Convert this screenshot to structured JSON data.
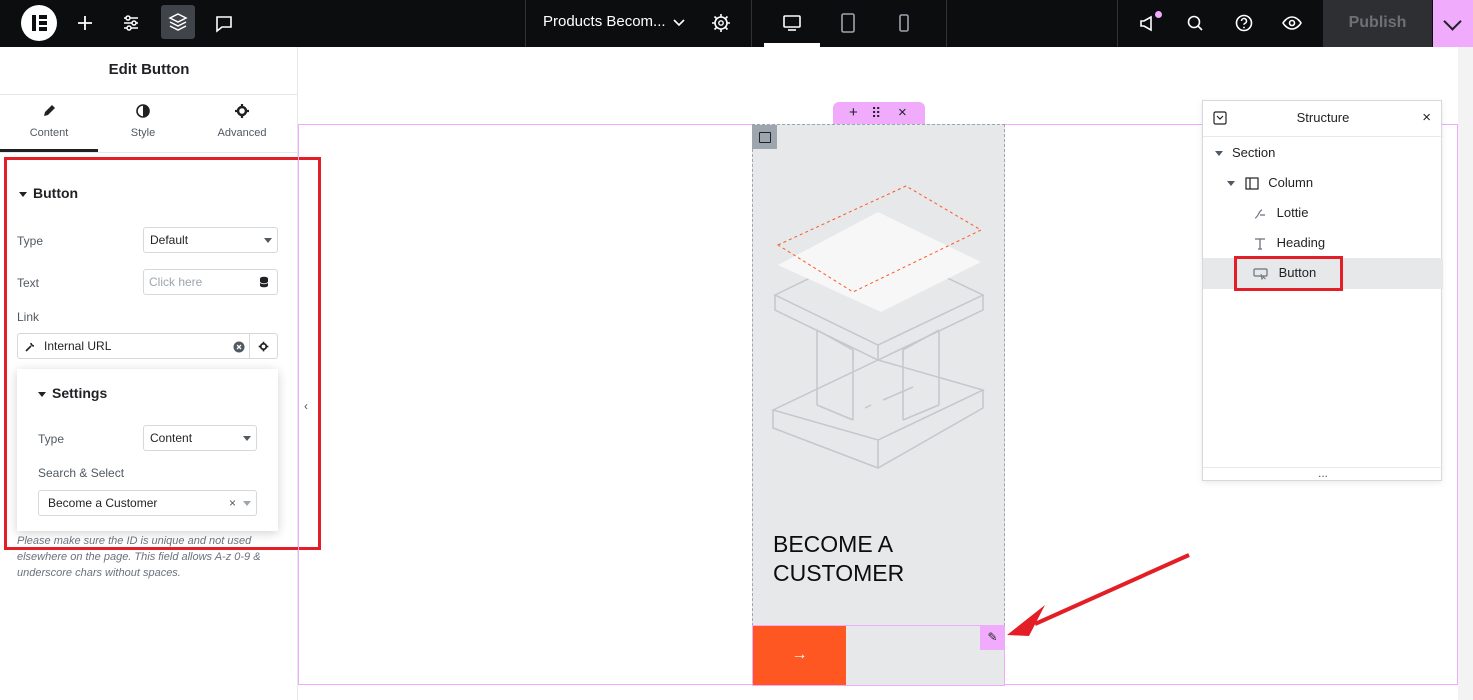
{
  "topbar": {
    "document_title": "Products Becom...",
    "publish_label": "Publish",
    "icons": [
      "elementor-logo-icon",
      "add-icon",
      "settings-sliders-icon",
      "layers-icon",
      "comments-icon",
      "chevron-down-icon",
      "gear-icon",
      "desktop-icon",
      "tablet-icon",
      "mobile-icon",
      "megaphone-icon",
      "search-icon",
      "help-icon",
      "preview-eye-icon",
      "chevron-down-icon"
    ],
    "accent_color": "#f0abfc"
  },
  "panel": {
    "title": "Edit Button",
    "tabs": [
      {
        "label": "Content",
        "icon": "pencil-icon",
        "active": true
      },
      {
        "label": "Style",
        "icon": "half-circle-icon"
      },
      {
        "label": "Advanced",
        "icon": "gear-icon"
      }
    ],
    "section_title": "Button",
    "type_label": "Type",
    "type_value": "Default",
    "text_label": "Text",
    "text_placeholder": "Click here",
    "link_label": "Link",
    "link_value": "Internal URL",
    "settings": {
      "title": "Settings",
      "type_label": "Type",
      "type_value": "Content",
      "search_label": "Search & Select",
      "search_value": "Become a Customer",
      "clear_symbol": "×"
    },
    "help_text": "Please make sure the ID is unique and not used elsewhere on the page. This field allows A-z  0-9 & underscore chars without spaces.",
    "collapse_symbol": "‹"
  },
  "canvas": {
    "heading": "BECOME A CUSTOMER",
    "button_arrow": "→",
    "section_handle": {
      "add": "+",
      "move": "⠿",
      "close": "×"
    },
    "edit_icon": "✎"
  },
  "structure": {
    "title": "Structure",
    "close": "×",
    "items": [
      {
        "label": "Section",
        "icon": "caret-down-icon"
      },
      {
        "label": "Column",
        "icon": "column-icon"
      },
      {
        "label": "Lottie",
        "icon": "lottie-icon"
      },
      {
        "label": "Heading",
        "icon": "heading-icon"
      },
      {
        "label": "Button",
        "icon": "button-icon",
        "selected": true
      }
    ],
    "footer": "..."
  }
}
